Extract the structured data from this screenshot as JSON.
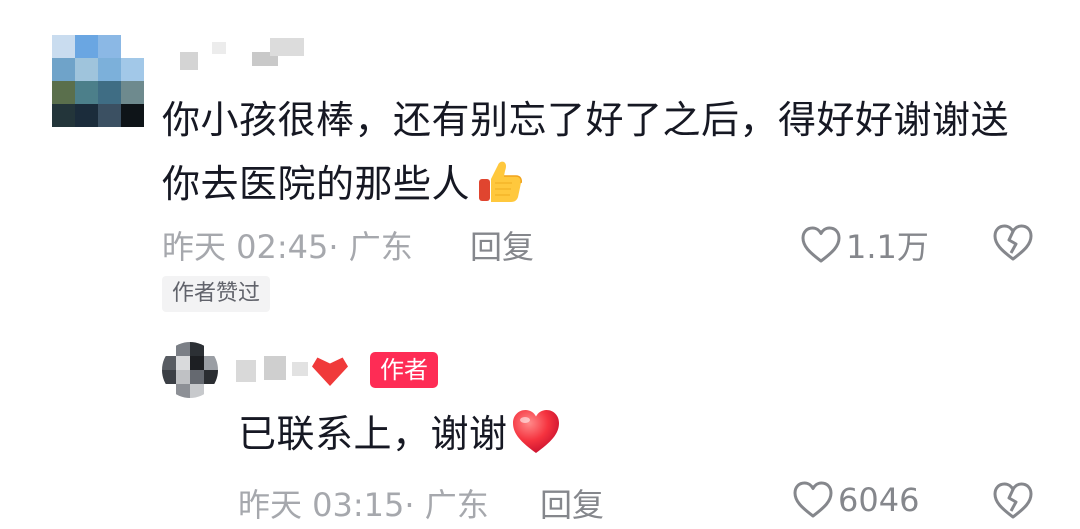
{
  "comment": {
    "text_line1": "你小孩很棒，还有别忘了好了之后，得好好谢谢送",
    "text_line2": "你去医院的那些人",
    "emoji": "thumbs-up",
    "time": "昨天 02:45",
    "location": "· 广东",
    "reply_label": "回复",
    "like_count": "1.1万",
    "author_liked_badge": "作者赞过"
  },
  "reply": {
    "author_badge": "作者",
    "text": "已联系上，谢谢",
    "emoji": "red-heart",
    "time": "昨天 03:15",
    "location": "· 广东",
    "reply_label": "回复",
    "like_count": "6046"
  },
  "colors": {
    "text_primary": "#161823",
    "text_secondary": "#a6a8ad",
    "accent": "#fe2c55",
    "badge_bg": "#f3f3f4"
  },
  "icons": [
    "heart-outline-icon",
    "broken-heart-icon",
    "thumbs-up-emoji",
    "red-heart-emoji"
  ]
}
